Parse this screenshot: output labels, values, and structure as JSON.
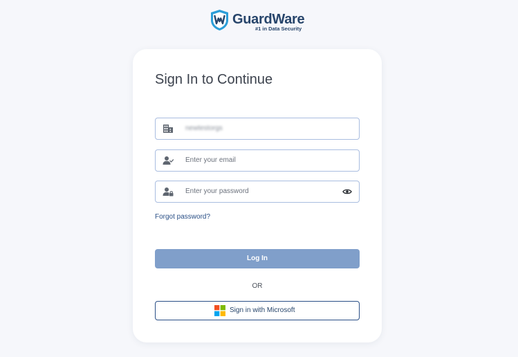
{
  "brand": {
    "name": "GuardWare",
    "tagline": "#1 in Data Security",
    "logo_letter": "W",
    "colors": {
      "primary": "#27456b",
      "accent": "#2b9ed8"
    }
  },
  "form": {
    "title": "Sign In to Continue",
    "organization": {
      "icon": "building-icon",
      "value": "newtestorgs"
    },
    "email": {
      "icon": "user-check-icon",
      "placeholder": "Enter your email"
    },
    "password": {
      "icon": "user-lock-icon",
      "placeholder": "Enter your password",
      "toggle_icon": "eye-icon"
    },
    "forgot_password": "Forgot password?",
    "login_button": "Log In",
    "divider": "OR",
    "microsoft_button": "Sign in with Microsoft"
  },
  "colors": {
    "page_background": "#f6f7fb",
    "card_background": "#ffffff",
    "input_border": "#a9bde0",
    "login_button": "#809fca",
    "link": "#2a4f86",
    "microsoft": [
      "#f25022",
      "#7fba00",
      "#00a4ef",
      "#ffb900"
    ]
  }
}
